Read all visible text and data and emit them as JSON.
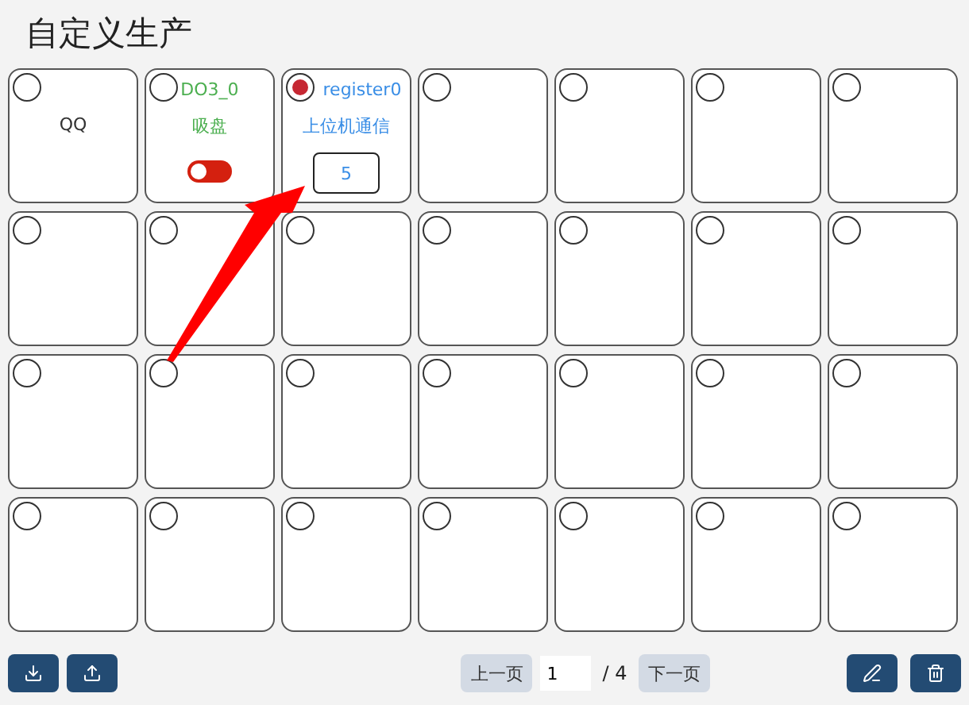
{
  "title": "自定义生产",
  "cells": [
    {
      "kind": "label",
      "selected": false,
      "text": "QQ"
    },
    {
      "kind": "switch",
      "selected": false,
      "name": "DO3_0",
      "label": "吸盘",
      "on": false
    },
    {
      "kind": "register",
      "selected": true,
      "name": "register0",
      "label": "上位机通信",
      "value": "5"
    },
    {
      "kind": "empty",
      "selected": false
    },
    {
      "kind": "empty",
      "selected": false
    },
    {
      "kind": "empty",
      "selected": false
    },
    {
      "kind": "empty",
      "selected": false
    },
    {
      "kind": "empty",
      "selected": false
    },
    {
      "kind": "empty",
      "selected": false
    },
    {
      "kind": "empty",
      "selected": false
    },
    {
      "kind": "empty",
      "selected": false
    },
    {
      "kind": "empty",
      "selected": false
    },
    {
      "kind": "empty",
      "selected": false
    },
    {
      "kind": "empty",
      "selected": false
    },
    {
      "kind": "empty",
      "selected": false
    },
    {
      "kind": "empty",
      "selected": false
    },
    {
      "kind": "empty",
      "selected": false
    },
    {
      "kind": "empty",
      "selected": false
    },
    {
      "kind": "empty",
      "selected": false
    },
    {
      "kind": "empty",
      "selected": false
    },
    {
      "kind": "empty",
      "selected": false
    },
    {
      "kind": "empty",
      "selected": false
    },
    {
      "kind": "empty",
      "selected": false
    },
    {
      "kind": "empty",
      "selected": false
    },
    {
      "kind": "empty",
      "selected": false
    },
    {
      "kind": "empty",
      "selected": false
    },
    {
      "kind": "empty",
      "selected": false
    },
    {
      "kind": "empty",
      "selected": false
    }
  ],
  "pager": {
    "prev": "上一页",
    "page": "1",
    "total": "/ 4",
    "next": "下一页"
  }
}
